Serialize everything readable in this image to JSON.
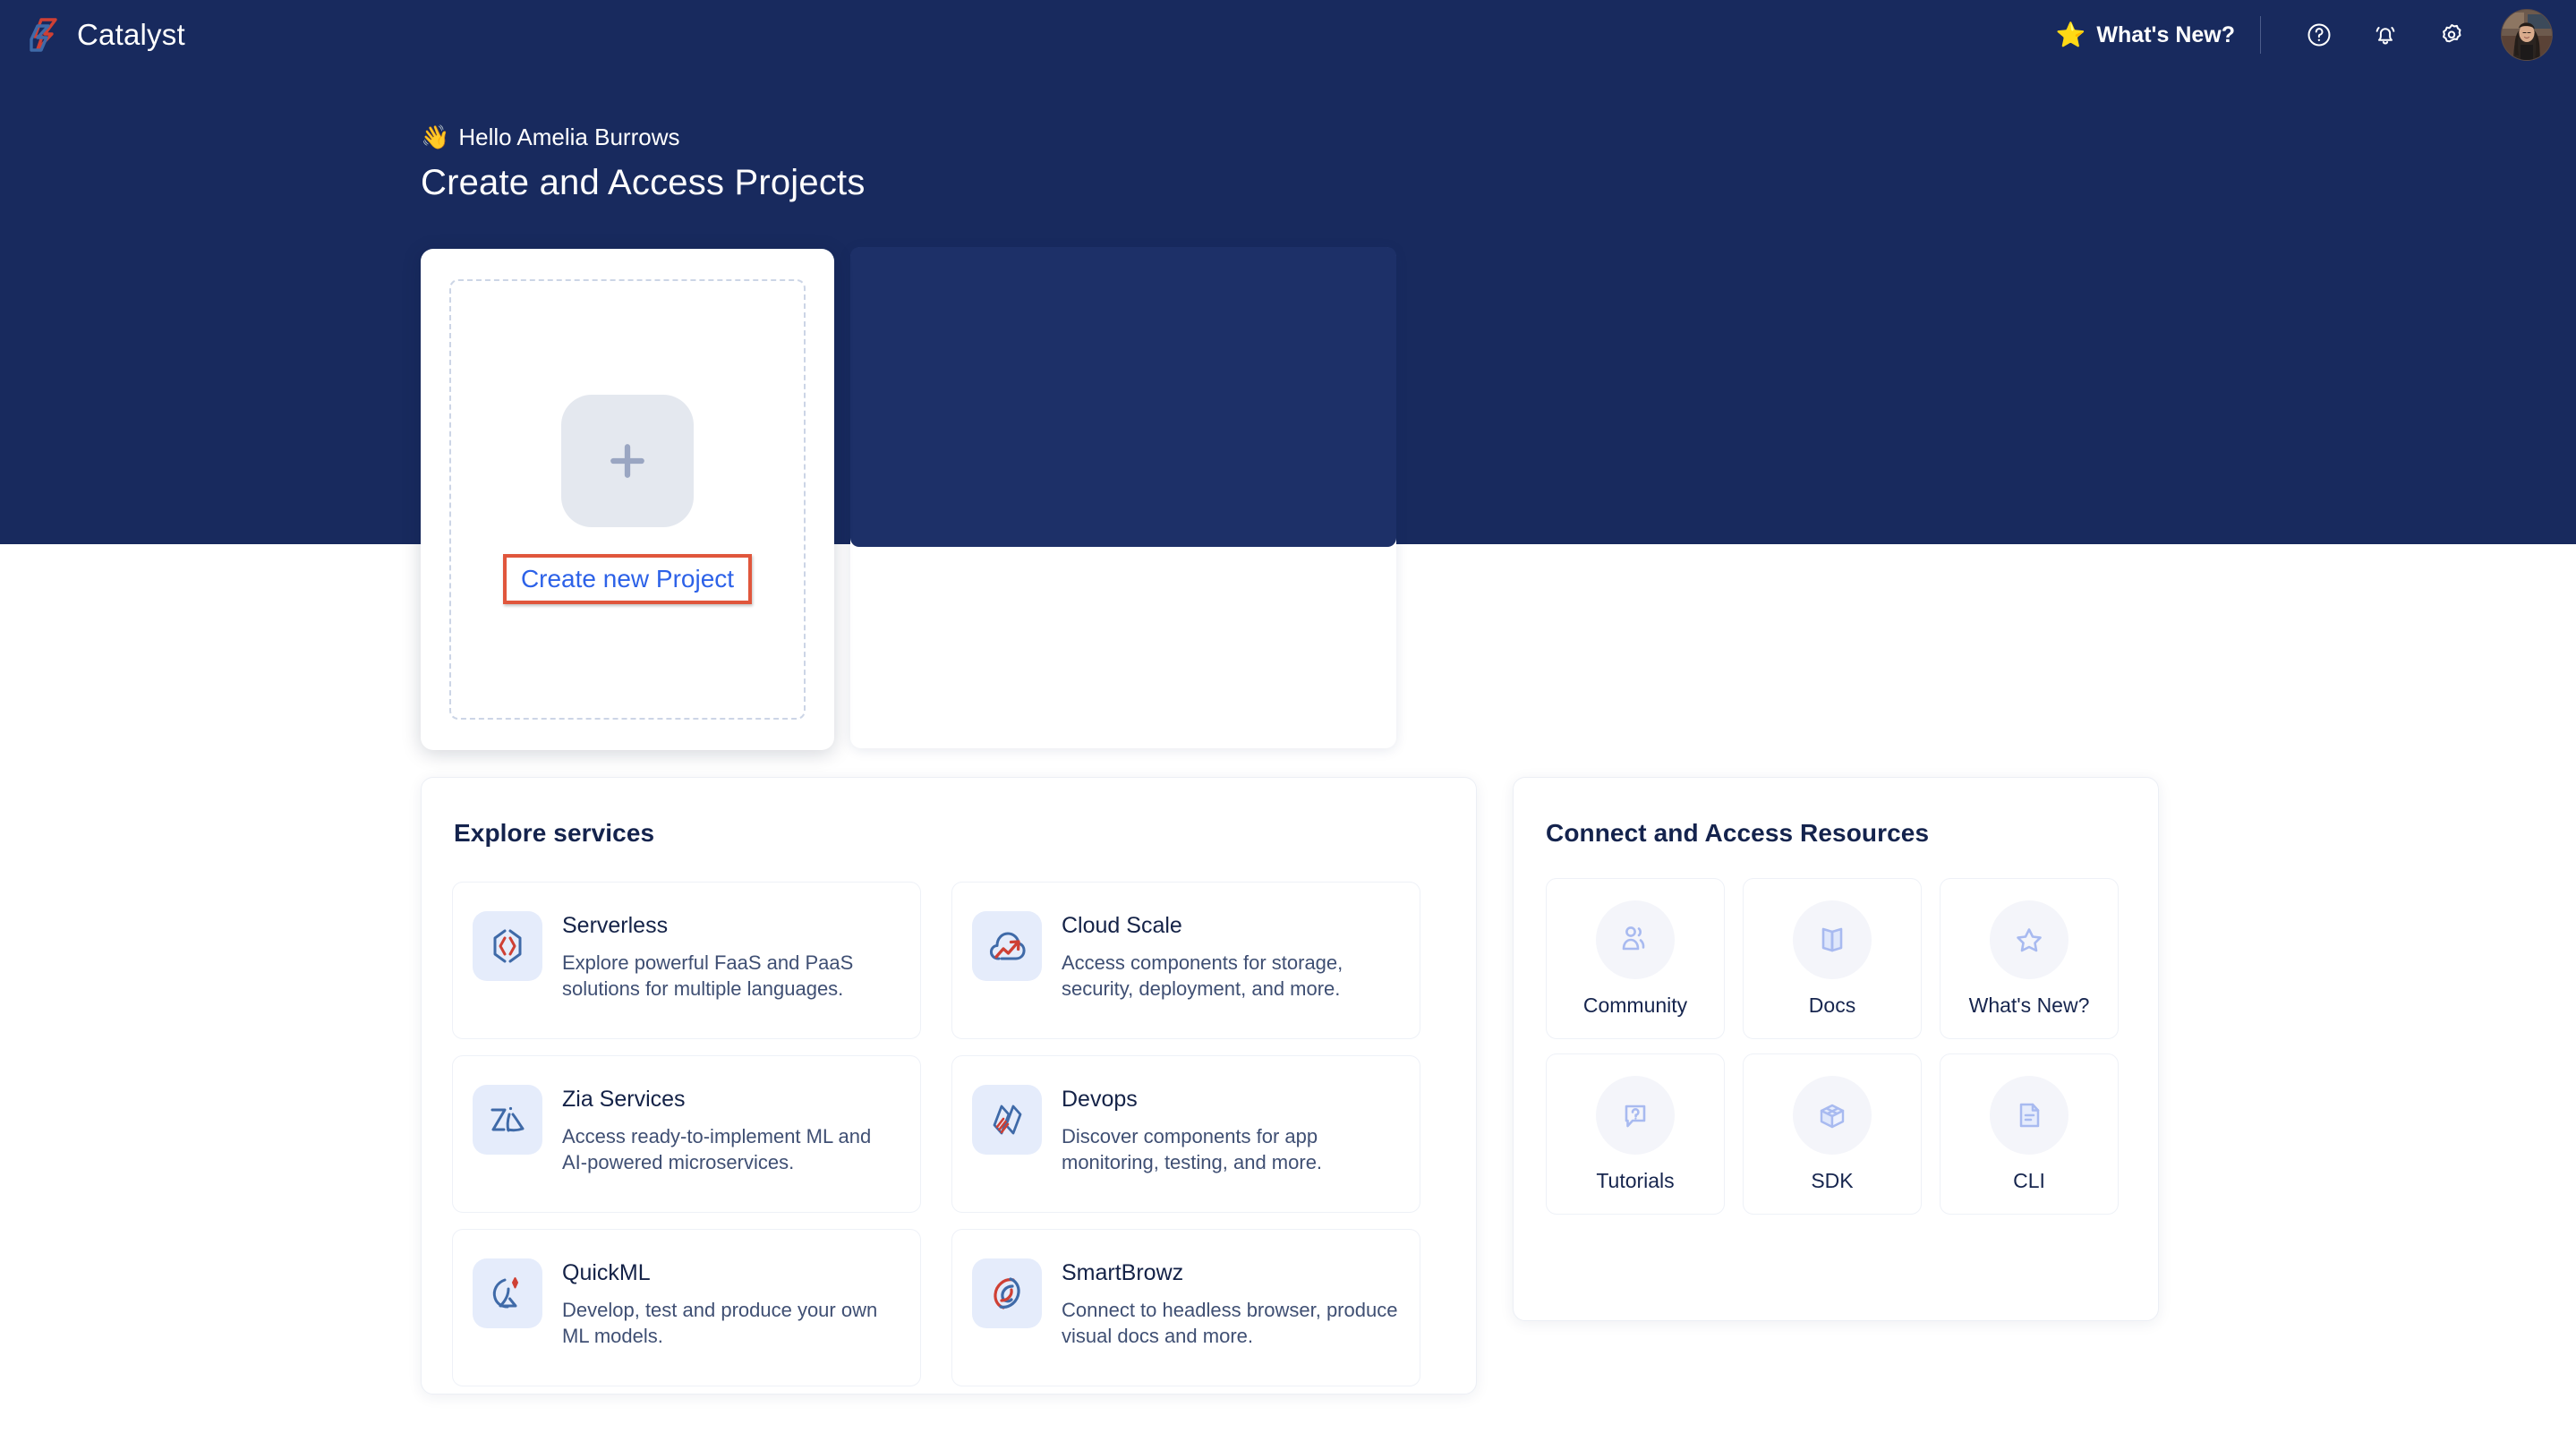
{
  "brand": {
    "name": "Catalyst",
    "logo_icon": "catalyst-chevron-logo"
  },
  "topbar": {
    "whats_new_label": "What's New?",
    "star_icon": "star-icon",
    "help_icon": "help-circle-icon",
    "notifications_icon": "bell-icon",
    "settings_icon": "gear-icon",
    "avatar_icon": "user-avatar"
  },
  "hero": {
    "greeting": "Hello Amelia Burrows",
    "greeting_emoji": "waving-hand-icon",
    "title": "Create and Access Projects"
  },
  "create_card": {
    "plus_icon": "plus-icon",
    "link_label": "Create new Project",
    "highlight_color": "#e0563c",
    "link_color": "#2d62e8"
  },
  "explore": {
    "title": "Explore services",
    "services": [
      {
        "name": "Serverless",
        "desc": "Explore powerful FaaS and PaaS solutions for multiple languages.",
        "icon": "code-brackets-icon"
      },
      {
        "name": "Cloud Scale",
        "desc": "Access components for storage, security, deployment, and more.",
        "icon": "cloud-arrow-icon"
      },
      {
        "name": "Zia Services",
        "desc": "Access ready-to-implement ML and AI-powered microservices.",
        "icon": "zia-script-icon"
      },
      {
        "name": "Devops",
        "desc": "Discover components for app monitoring, testing, and more.",
        "icon": "double-diamond-icon"
      },
      {
        "name": "QuickML",
        "desc": "Develop, test and produce your own ML models.",
        "icon": "quickml-flask-icon"
      },
      {
        "name": "SmartBrowz",
        "desc": "Connect to headless browser, produce visual docs and more.",
        "icon": "smartbrowz-swirl-icon"
      }
    ]
  },
  "connect": {
    "title": "Connect and Access Resources",
    "resources": [
      {
        "label": "Community",
        "icon": "people-icon"
      },
      {
        "label": "Docs",
        "icon": "open-book-icon"
      },
      {
        "label": "What's New?",
        "icon": "star-outline-icon"
      },
      {
        "label": "Tutorials",
        "icon": "question-bubble-icon"
      },
      {
        "label": "SDK",
        "icon": "open-box-icon"
      },
      {
        "label": "CLI",
        "icon": "document-lines-icon"
      }
    ]
  },
  "colors": {
    "navy": "#182a5e",
    "accent_blue": "#3a6bbd",
    "accent_red": "#cf4034",
    "link_blue": "#2d62e8",
    "highlight_orange": "#e0563c",
    "icon_tile_bg": "#e5ecfb",
    "resource_icon": "#a8baf0"
  }
}
